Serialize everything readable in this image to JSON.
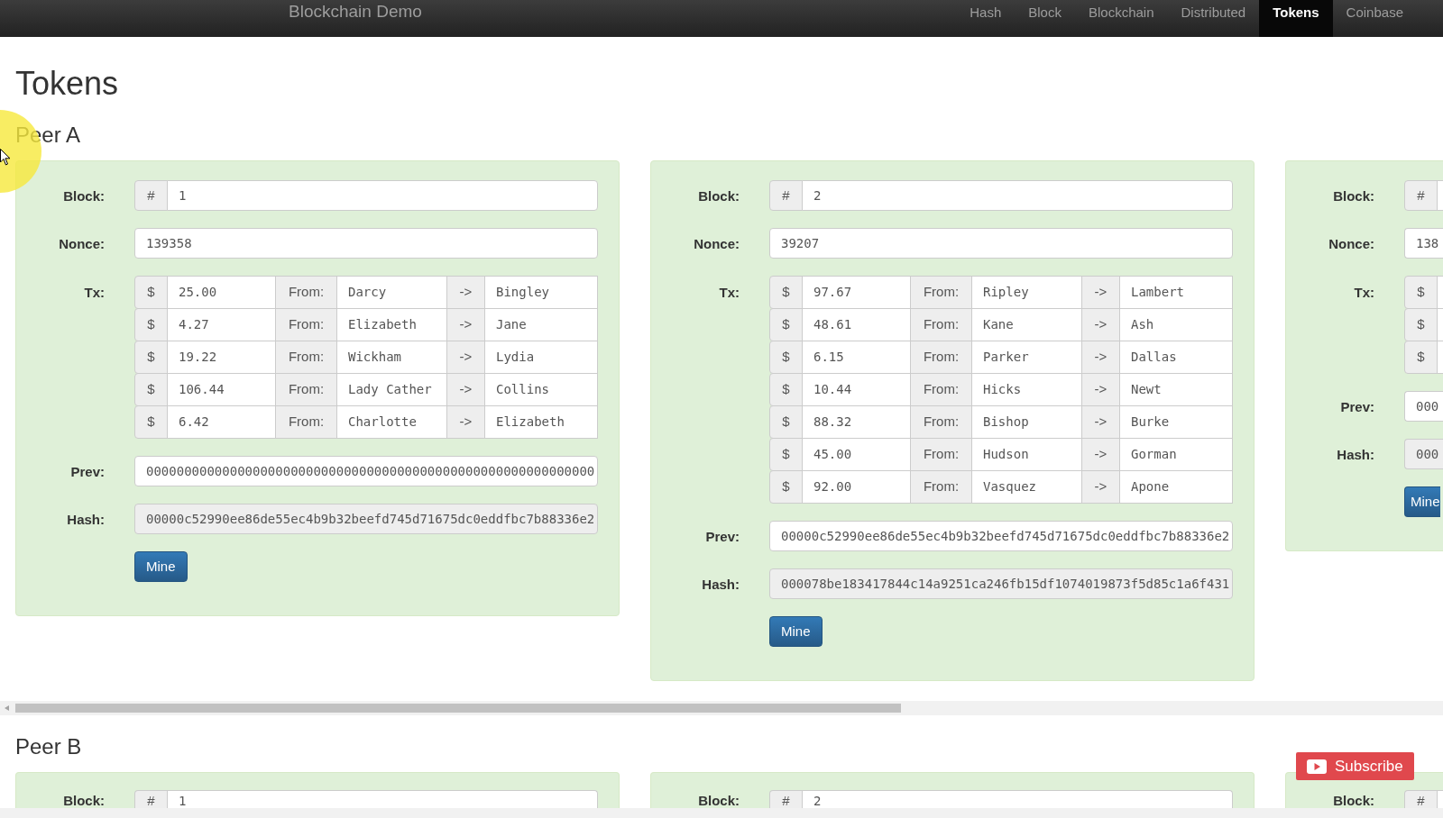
{
  "navbar": {
    "brand": "Blockchain Demo",
    "items": [
      {
        "label": "Hash",
        "selected": false
      },
      {
        "label": "Block",
        "selected": false
      },
      {
        "label": "Blockchain",
        "selected": false
      },
      {
        "label": "Distributed",
        "selected": false
      },
      {
        "label": "Tokens",
        "selected": true
      },
      {
        "label": "Coinbase",
        "selected": false
      }
    ]
  },
  "page": {
    "title": "Tokens"
  },
  "peers": [
    {
      "name": "Peer A",
      "blocks": [
        {
          "kind": "full",
          "block_label": "Block:",
          "block_prefix": "#",
          "block": "1",
          "nonce_label": "Nonce:",
          "nonce": "139358",
          "tx_label": "Tx:",
          "tx": [
            {
              "currency": "$",
              "amount": "25.00",
              "from_label": "From:",
              "from": "Darcy",
              "arrow": "->",
              "to": "Bingley"
            },
            {
              "currency": "$",
              "amount": "4.27",
              "from_label": "From:",
              "from": "Elizabeth",
              "arrow": "->",
              "to": "Jane"
            },
            {
              "currency": "$",
              "amount": "19.22",
              "from_label": "From:",
              "from": "Wickham",
              "arrow": "->",
              "to": "Lydia"
            },
            {
              "currency": "$",
              "amount": "106.44",
              "from_label": "From:",
              "from": "Lady Cather",
              "arrow": "->",
              "to": "Collins"
            },
            {
              "currency": "$",
              "amount": "6.42",
              "from_label": "From:",
              "from": "Charlotte",
              "arrow": "->",
              "to": "Elizabeth"
            }
          ],
          "prev_label": "Prev:",
          "prev": "00000000000000000000000000000000000000000000000000000000000",
          "hash_label": "Hash:",
          "hash": "00000c52990ee86de55ec4b9b32beefd745d71675dc0eddfbc7b88336e2",
          "button": "Mine"
        },
        {
          "kind": "full",
          "block_label": "Block:",
          "block_prefix": "#",
          "block": "2",
          "nonce_label": "Nonce:",
          "nonce": "39207",
          "tx_label": "Tx:",
          "tx": [
            {
              "currency": "$",
              "amount": "97.67",
              "from_label": "From:",
              "from": "Ripley",
              "arrow": "->",
              "to": "Lambert"
            },
            {
              "currency": "$",
              "amount": "48.61",
              "from_label": "From:",
              "from": "Kane",
              "arrow": "->",
              "to": "Ash"
            },
            {
              "currency": "$",
              "amount": "6.15",
              "from_label": "From:",
              "from": "Parker",
              "arrow": "->",
              "to": "Dallas"
            },
            {
              "currency": "$",
              "amount": "10.44",
              "from_label": "From:",
              "from": "Hicks",
              "arrow": "->",
              "to": "Newt"
            },
            {
              "currency": "$",
              "amount": "88.32",
              "from_label": "From:",
              "from": "Bishop",
              "arrow": "->",
              "to": "Burke"
            },
            {
              "currency": "$",
              "amount": "45.00",
              "from_label": "From:",
              "from": "Hudson",
              "arrow": "->",
              "to": "Gorman"
            },
            {
              "currency": "$",
              "amount": "92.00",
              "from_label": "From:",
              "from": "Vasquez",
              "arrow": "->",
              "to": "Apone"
            }
          ],
          "prev_label": "Prev:",
          "prev": "00000c52990ee86de55ec4b9b32beefd745d71675dc0eddfbc7b88336e2",
          "hash_label": "Hash:",
          "hash": "000078be183417844c14a9251ca246fb15df1074019873f5d85c1a6f431",
          "button": "Mine"
        },
        {
          "kind": "right_edge",
          "block_label": "Block:",
          "block_prefix": "#",
          "nonce_label": "Nonce:",
          "nonce": "138",
          "tx_label": "Tx:",
          "tx": [
            {
              "currency": "$"
            },
            {
              "currency": "$"
            },
            {
              "currency": "$"
            }
          ],
          "prev_label": "Prev:",
          "prev": "000",
          "hash_label": "Hash:",
          "hash": "000",
          "button": "Mine"
        }
      ]
    },
    {
      "name": "Peer B",
      "blocks": [
        {
          "kind": "bottom_edge",
          "block_label": "Block:",
          "block_prefix": "#",
          "block": "1"
        },
        {
          "kind": "bottom_edge",
          "block_label": "Block:",
          "block_prefix": "#",
          "block": "2"
        },
        {
          "kind": "corner",
          "block_label": "Block:",
          "block_prefix": "#"
        }
      ]
    }
  ],
  "subscribe_button": {
    "label": "Subscribe"
  }
}
